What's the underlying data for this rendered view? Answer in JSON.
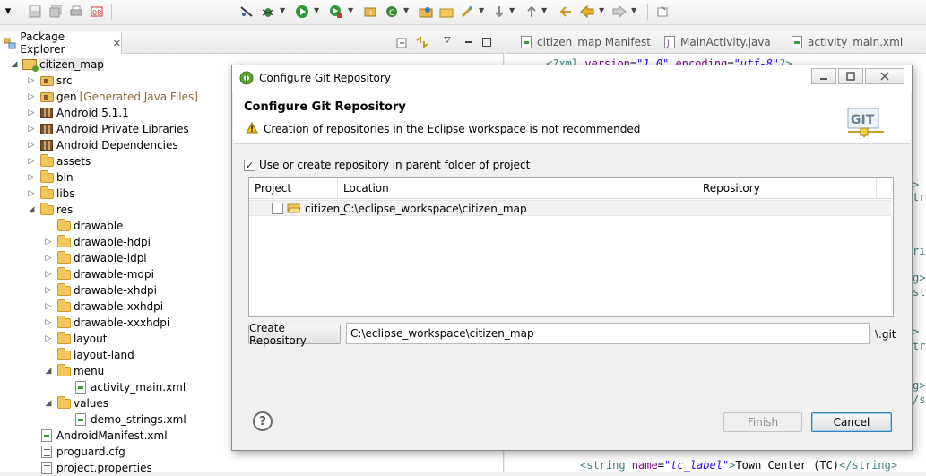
{
  "explorer": {
    "tab_label": "Package Explorer",
    "tree": [
      {
        "label": "citizen_map",
        "decoration": "",
        "icon": "project-icon",
        "level": 0,
        "twisty": "expanded"
      },
      {
        "label": "src",
        "decoration": "",
        "icon": "package-folder-icon",
        "level": 1,
        "twisty": "collapsed"
      },
      {
        "label": "gen",
        "decoration": "[Generated Java Files]",
        "icon": "package-folder-icon",
        "level": 1,
        "twisty": "collapsed"
      },
      {
        "label": "Android 5.1.1",
        "decoration": "",
        "icon": "library-icon",
        "level": 1,
        "twisty": "collapsed"
      },
      {
        "label": "Android Private Libraries",
        "decoration": "",
        "icon": "library-icon",
        "level": 1,
        "twisty": "collapsed"
      },
      {
        "label": "Android Dependencies",
        "decoration": "",
        "icon": "library-icon",
        "level": 1,
        "twisty": "collapsed"
      },
      {
        "label": "assets",
        "decoration": "",
        "icon": "folder-icon",
        "level": 1,
        "twisty": "collapsed"
      },
      {
        "label": "bin",
        "decoration": "",
        "icon": "folder-icon",
        "level": 1,
        "twisty": "collapsed"
      },
      {
        "label": "libs",
        "decoration": "",
        "icon": "folder-icon",
        "level": 1,
        "twisty": "collapsed"
      },
      {
        "label": "res",
        "decoration": "",
        "icon": "folder-icon",
        "level": 1,
        "twisty": "expanded"
      },
      {
        "label": "drawable",
        "decoration": "",
        "icon": "folder-icon",
        "level": 2,
        "twisty": "none"
      },
      {
        "label": "drawable-hdpi",
        "decoration": "",
        "icon": "folder-icon",
        "level": 2,
        "twisty": "collapsed"
      },
      {
        "label": "drawable-ldpi",
        "decoration": "",
        "icon": "folder-icon",
        "level": 2,
        "twisty": "collapsed"
      },
      {
        "label": "drawable-mdpi",
        "decoration": "",
        "icon": "folder-icon",
        "level": 2,
        "twisty": "collapsed"
      },
      {
        "label": "drawable-xhdpi",
        "decoration": "",
        "icon": "folder-icon",
        "level": 2,
        "twisty": "collapsed"
      },
      {
        "label": "drawable-xxhdpi",
        "decoration": "",
        "icon": "folder-icon",
        "level": 2,
        "twisty": "collapsed"
      },
      {
        "label": "drawable-xxxhdpi",
        "decoration": "",
        "icon": "folder-icon",
        "level": 2,
        "twisty": "collapsed"
      },
      {
        "label": "layout",
        "decoration": "",
        "icon": "folder-icon",
        "level": 2,
        "twisty": "collapsed"
      },
      {
        "label": "layout-land",
        "decoration": "",
        "icon": "folder-icon",
        "level": 2,
        "twisty": "none"
      },
      {
        "label": "menu",
        "decoration": "",
        "icon": "folder-icon",
        "level": 2,
        "twisty": "expanded"
      },
      {
        "label": "activity_main.xml",
        "decoration": "",
        "icon": "xml-file-icon",
        "level": 3,
        "twisty": "none"
      },
      {
        "label": "values",
        "decoration": "",
        "icon": "folder-icon",
        "level": 2,
        "twisty": "expanded"
      },
      {
        "label": "demo_strings.xml",
        "decoration": "",
        "icon": "xml-file-icon",
        "level": 3,
        "twisty": "none"
      },
      {
        "label": "AndroidManifest.xml",
        "decoration": "",
        "icon": "xml-file-icon",
        "level": 1,
        "twisty": "none"
      },
      {
        "label": "proguard.cfg",
        "decoration": "",
        "icon": "config-file-icon",
        "level": 1,
        "twisty": "none"
      },
      {
        "label": "project.properties",
        "decoration": "",
        "icon": "config-file-icon",
        "level": 1,
        "twisty": "none"
      }
    ]
  },
  "editor": {
    "tabs": [
      "citizen_map Manifest",
      "MainActivity.java",
      "activity_main.xml"
    ],
    "line1": {
      "open": "<?xml ",
      "a1": "version",
      "eq1": "=",
      "v1": "\"1.0\"",
      "a2": " encoding",
      "eq2": "=",
      "v2": "\"utf-8\"",
      "close": "?>"
    },
    "line_last": {
      "open": "<string ",
      "attr": "name",
      "eq": "=",
      "val": "\"tc_label\"",
      "close": ">",
      "text": "Town Center (TC)",
      "end": "</string>"
    },
    "edge_fragments": [
      ">",
      "tri",
      "ring",
      "g>",
      "str",
      ">",
      "tri",
      "g>",
      "/st"
    ]
  },
  "dialog": {
    "window_title": "Configure Git Repository",
    "header_title": "Configure Git Repository",
    "warning_text": "Creation of repositories in the Eclipse workspace is not recommended",
    "logo_text": "GIT",
    "use_parent_label": "Use or create repository in parent folder of project",
    "use_parent_checked": true,
    "table": {
      "headers": [
        "Project",
        "Location",
        "Repository"
      ],
      "rows": [
        {
          "checked": false,
          "project": "citizen_",
          "location": "C:\\eclipse_workspace\\citizen_map",
          "repository": ""
        }
      ]
    },
    "create_repo_label": "Create Repository",
    "path_value": "C:\\eclipse_workspace\\citizen_map",
    "path_suffix": "\\.git",
    "finish_label": "Finish",
    "cancel_label": "Cancel"
  }
}
